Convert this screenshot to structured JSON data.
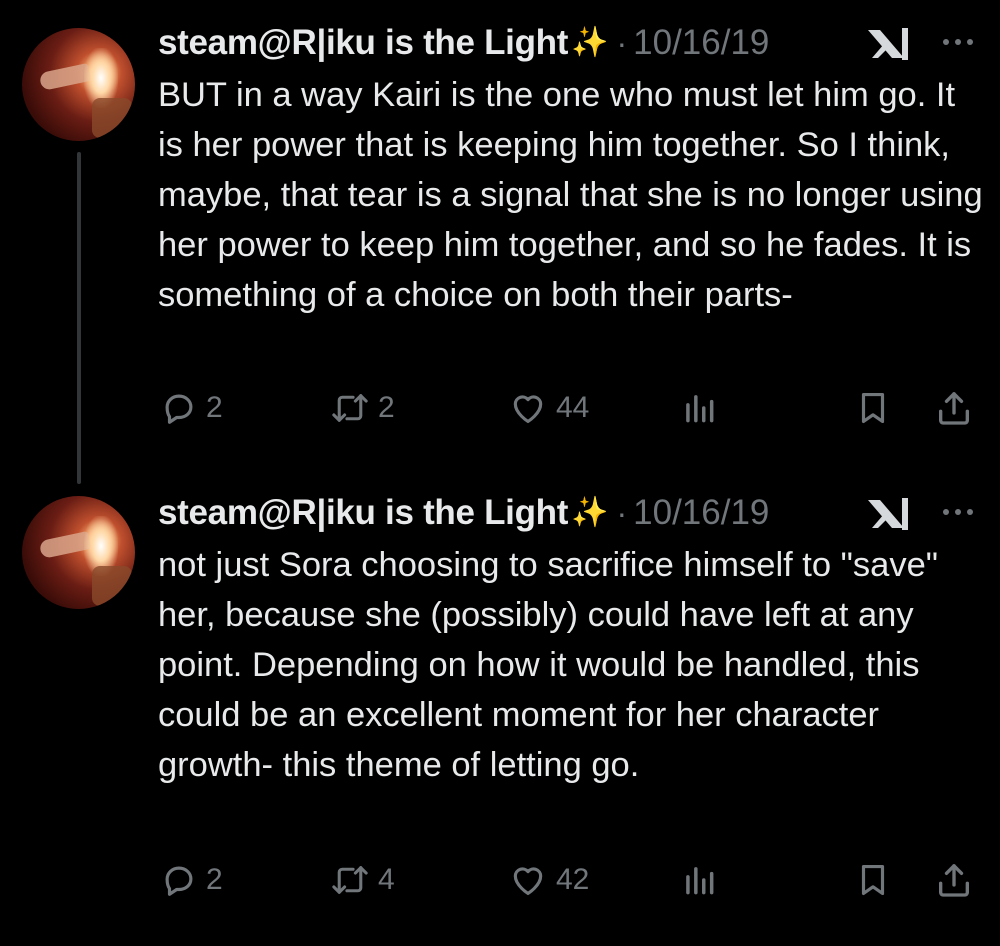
{
  "tweets": [
    {
      "author": "steam@R|iku is the Light",
      "emoji": "✨",
      "separator": "·",
      "date": "10/16/19",
      "text": "BUT in a way Kairi is the one who must let him go. It is her power that is keeping him together. So I think, maybe, that tear is a signal that she is no longer using her power to keep him together, and so he fades. It is something of a choice on both their parts-",
      "replies": "2",
      "retweets": "2",
      "likes": "44"
    },
    {
      "author": "steam@R|iku is the Light",
      "emoji": "✨",
      "separator": "·",
      "date": "10/16/19",
      "text": "not just Sora choosing to sacrifice himself to \"save\" her, because she (possibly) could have left at any point. Depending on how it would be handled, this could be an excellent moment for her character growth- this theme of letting go.",
      "replies": "2",
      "retweets": "4",
      "likes": "42"
    }
  ],
  "icons": {
    "reply": "reply-icon",
    "retweet": "retweet-icon",
    "like": "heart-icon",
    "views": "views-icon",
    "bookmark": "bookmark-icon",
    "share": "share-icon",
    "more": "more-icon",
    "badge": "x-logo-icon"
  },
  "colors": {
    "background": "#000000",
    "text": "#e7e9ea",
    "muted": "#71767b",
    "thread_line": "#333639",
    "sparkle": "#ffcc33"
  }
}
